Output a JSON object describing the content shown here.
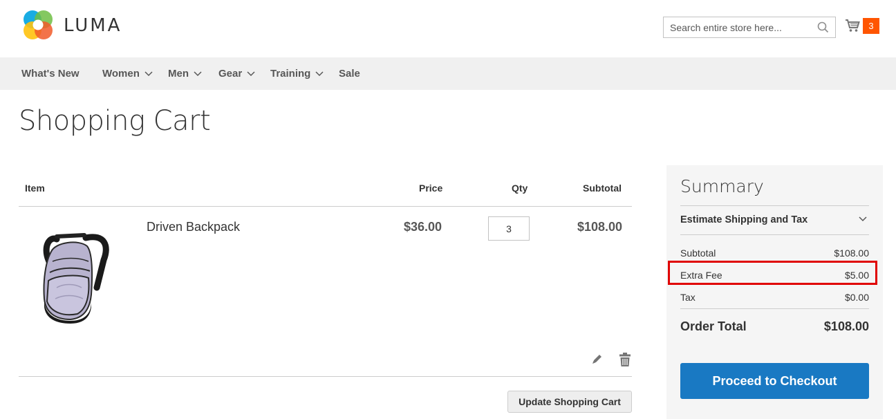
{
  "header": {
    "logo_text": "LUMA",
    "search_placeholder": "Search entire store here...",
    "cart_count": "3"
  },
  "nav": {
    "items": [
      {
        "label": "What's New",
        "dropdown": false
      },
      {
        "label": "Women",
        "dropdown": true
      },
      {
        "label": "Men",
        "dropdown": true
      },
      {
        "label": "Gear",
        "dropdown": true
      },
      {
        "label": "Training",
        "dropdown": true
      },
      {
        "label": "Sale",
        "dropdown": false
      }
    ]
  },
  "page_title": "Shopping Cart",
  "cart": {
    "columns": {
      "item": "Item",
      "price": "Price",
      "qty": "Qty",
      "subtotal": "Subtotal"
    },
    "items": [
      {
        "name": "Driven Backpack",
        "price": "$36.00",
        "qty": "3",
        "subtotal": "$108.00"
      }
    ],
    "update_label": "Update Shopping Cart"
  },
  "summary": {
    "title": "Summary",
    "estimate_label": "Estimate Shipping and Tax",
    "subtotal_label": "Subtotal",
    "subtotal_value": "$108.00",
    "extra_fee_label": "Extra Fee",
    "extra_fee_value": "$5.00",
    "tax_label": "Tax",
    "tax_value": "$0.00",
    "order_total_label": "Order Total",
    "order_total_value": "$108.00",
    "checkout_label": "Proceed to Checkout"
  },
  "colors": {
    "accent": "#1979c3",
    "cart_badge": "#ff5501",
    "highlight_box": "#e00000",
    "nav_bg": "#f0f0f0",
    "summary_bg": "#f5f5f5"
  },
  "icons": [
    "luma-logo-icon",
    "search-icon",
    "cart-icon",
    "chevron-down-icon",
    "edit-icon",
    "trash-icon"
  ]
}
